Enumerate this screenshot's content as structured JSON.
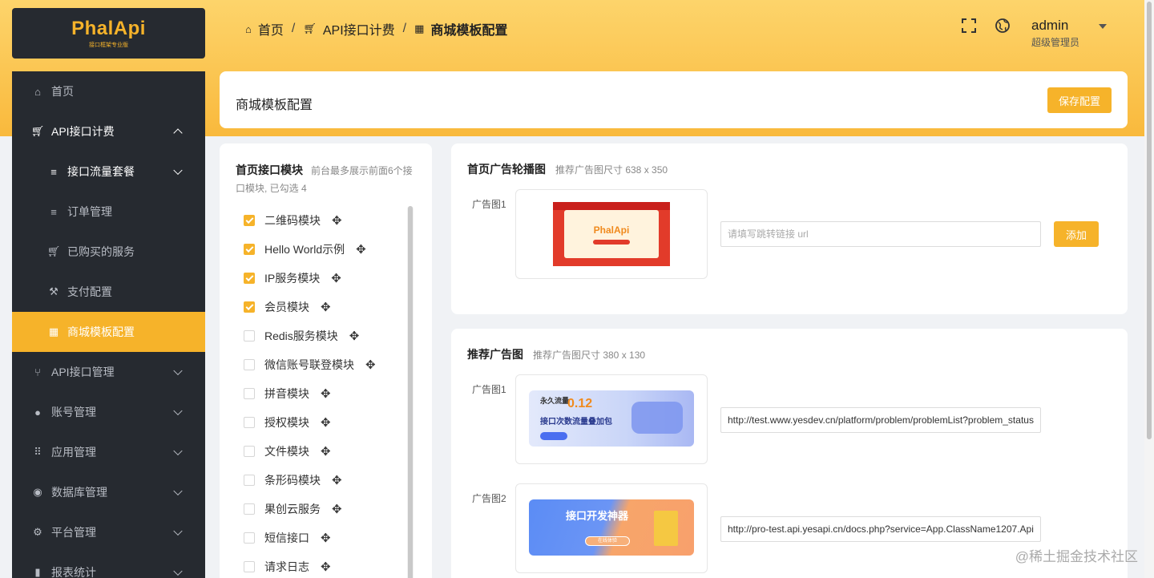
{
  "app": {
    "logo_text": "PhalApi",
    "logo_sub": "接口框架专业版"
  },
  "sidebar": {
    "items": [
      {
        "label": "首页",
        "icon": "home-icon"
      },
      {
        "label": "API接口计费",
        "icon": "cart-icon"
      },
      {
        "label": "接口流量套餐",
        "icon": "list-icon"
      },
      {
        "label": "订单管理",
        "icon": "list-icon"
      },
      {
        "label": "已购买的服务",
        "icon": "cart-icon"
      },
      {
        "label": "支付配置",
        "icon": "wrench-icon"
      },
      {
        "label": "商城模板配置",
        "icon": "basket-icon"
      },
      {
        "label": "API接口管理",
        "icon": "fork-icon"
      },
      {
        "label": "账号管理",
        "icon": "user-icon"
      },
      {
        "label": "应用管理",
        "icon": "grid-icon"
      },
      {
        "label": "数据库管理",
        "icon": "database-icon"
      },
      {
        "label": "平台管理",
        "icon": "gear-icon"
      },
      {
        "label": "报表统计",
        "icon": "chart-icon"
      }
    ]
  },
  "header": {
    "breadcrumb": [
      "首页",
      "API接口计费",
      "商城模板配置"
    ],
    "user_name": "admin",
    "user_role": "超级管理员"
  },
  "page": {
    "title": "商城模板配置",
    "save_label": "保存配置"
  },
  "modules": {
    "title": "首页接口模块",
    "desc": "前台最多展示前面6个接口模块, 已勾选 4",
    "items": [
      {
        "label": "二维码模块",
        "checked": true
      },
      {
        "label": "Hello World示例",
        "checked": true
      },
      {
        "label": "IP服务模块",
        "checked": true
      },
      {
        "label": "会员模块",
        "checked": true
      },
      {
        "label": "Redis服务模块",
        "checked": false
      },
      {
        "label": "微信账号联登模块",
        "checked": false
      },
      {
        "label": "拼音模块",
        "checked": false
      },
      {
        "label": "授权模块",
        "checked": false
      },
      {
        "label": "文件模块",
        "checked": false
      },
      {
        "label": "条形码模块",
        "checked": false
      },
      {
        "label": "果创云服务",
        "checked": false
      },
      {
        "label": "短信接口",
        "checked": false
      },
      {
        "label": "请求日志",
        "checked": false
      }
    ]
  },
  "carousel": {
    "title": "首页广告轮播图",
    "desc": "推荐广告图尺寸 638 x 350",
    "ad_label": "广告图1",
    "banner_text": "PhalApi",
    "url_placeholder": "请填写跳转链接 url",
    "add_label": "添加"
  },
  "recommend": {
    "title": "推荐广告图",
    "desc": "推荐广告图尺寸 380 x 130",
    "ads": [
      {
        "label": "广告图1",
        "url": "http://test.www.yesdev.cn/platform/problem/problemList?problem_status",
        "banner_big": "0.12",
        "banner_badge": "永久流量",
        "banner_line": "接口次数流量叠加包"
      },
      {
        "label": "广告图2",
        "url": "http://pro-test.api.yesapi.cn/docs.php?service=App.ClassName1207.Api",
        "banner_line": "接口开发神器",
        "banner_btn": "在线体验"
      }
    ]
  },
  "watermark": "@稀土掘金技术社区",
  "colors": {
    "accent": "#f6b32a",
    "sidebar": "#262a30"
  }
}
